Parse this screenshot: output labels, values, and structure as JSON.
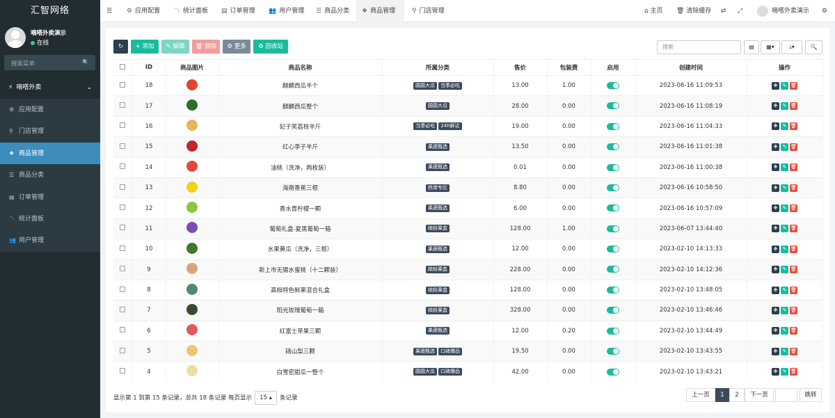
{
  "sidebar": {
    "brand": "汇智网络",
    "user_name": "嘀嗒外卖演示",
    "user_status": "在线",
    "search_placeholder": "搜索菜单",
    "group_label": "嘀嗒外卖",
    "items": [
      {
        "label": "应用配置",
        "icon": "gear-icon"
      },
      {
        "label": "门店管理",
        "icon": "map-marker-icon"
      },
      {
        "label": "商品管理",
        "icon": "cubes-icon",
        "active": true
      },
      {
        "label": "商品分类",
        "icon": "list-icon"
      },
      {
        "label": "订单管理",
        "icon": "file-icon"
      },
      {
        "label": "统计面板",
        "icon": "chart-icon"
      },
      {
        "label": "用户管理",
        "icon": "users-icon"
      }
    ]
  },
  "topbar": {
    "tabs": [
      {
        "label": "应用配置"
      },
      {
        "label": "统计面板"
      },
      {
        "label": "订单管理"
      },
      {
        "label": "用户管理"
      },
      {
        "label": "商品分类"
      },
      {
        "label": "商品管理",
        "active": true
      },
      {
        "label": "门店管理"
      }
    ],
    "home": "主页",
    "clear_cache": "清除缓存",
    "user_name": "嘀嗒外卖演示"
  },
  "toolbar": {
    "add": "添加",
    "edit": "编辑",
    "delete": "删除",
    "more": "更多",
    "recycle": "回收站",
    "search_placeholder": "搜索"
  },
  "table": {
    "headers": [
      "ID",
      "商品图片",
      "商品名称",
      "所属分类",
      "售价",
      "包装费",
      "启用",
      "创建时间",
      "操作"
    ],
    "rows": [
      {
        "id": "18",
        "name": "麒麟西瓜半个",
        "tags": [
          "圆圆大瓜",
          "当季必吃"
        ],
        "price": "13.00",
        "pack": "1.00",
        "time": "2023-06-16 11:09:53",
        "color": "#e0452f"
      },
      {
        "id": "17",
        "name": "麒麟西瓜整个",
        "tags": [
          "圆圆大瓜"
        ],
        "price": "28.00",
        "pack": "0.00",
        "time": "2023-06-16 11:08:19",
        "color": "#2f6b2a"
      },
      {
        "id": "16",
        "name": "妃子笑荔枝半斤",
        "tags": [
          "当季必吃",
          "24h鲜达"
        ],
        "price": "19.00",
        "pack": "0.00",
        "time": "2023-06-16 11:04:33",
        "color": "#e7b45a"
      },
      {
        "id": "15",
        "name": "红心李子半斤",
        "tags": [
          "果蔬甄选"
        ],
        "price": "13.50",
        "pack": "0.00",
        "time": "2023-06-16 11:01:38",
        "color": "#c0262b"
      },
      {
        "id": "14",
        "name": "油桃（洗净，两枚装）",
        "tags": [
          "果蔬甄选"
        ],
        "price": "0.01",
        "pack": "0.00",
        "time": "2023-06-16 11:00:38",
        "color": "#e04a3c"
      },
      {
        "id": "13",
        "name": "海南香蕉三根",
        "tags": [
          "热带专区"
        ],
        "price": "8.80",
        "pack": "0.00",
        "time": "2023-06-16 10:58:50",
        "color": "#f3cf1e"
      },
      {
        "id": "12",
        "name": "香水青柠檬一颗",
        "tags": [
          "果蔬甄选"
        ],
        "price": "6.00",
        "pack": "0.00",
        "time": "2023-06-16 10:57:09",
        "color": "#8cc63f"
      },
      {
        "id": "11",
        "name": "葡萄礼盒-夏黑葡萄一箱",
        "tags": [
          "缤纷果盒"
        ],
        "price": "128.00",
        "pack": "1.00",
        "time": "2023-06-07 13:44:40",
        "color": "#7a4fb5"
      },
      {
        "id": "10",
        "name": "水果黄瓜（洗净，三根）",
        "tags": [
          "果蔬甄选"
        ],
        "price": "12.00",
        "pack": "0.00",
        "time": "2023-02-10 14:13:33",
        "color": "#3d7a2a"
      },
      {
        "id": "9",
        "name": "新上市无锡水蜜桃（十二颗装）",
        "tags": [
          "缤纷果盒"
        ],
        "price": "228.00",
        "pack": "0.00",
        "time": "2023-02-10 14:12:36",
        "color": "#d9a47a"
      },
      {
        "id": "8",
        "name": "高档特色鲜果混合礼盒",
        "tags": [
          "缤纷果盒"
        ],
        "price": "128.00",
        "pack": "0.00",
        "time": "2023-02-10 13:48:05",
        "color": "#4e8a6e"
      },
      {
        "id": "7",
        "name": "阳光玫瑰葡萄一箱",
        "tags": [
          "缤纷果盒"
        ],
        "price": "328.00",
        "pack": "0.00",
        "time": "2023-02-10 13:46:46",
        "color": "#3b4a2e"
      },
      {
        "id": "6",
        "name": "红富士苹果三颗",
        "tags": [
          "果蔬甄选"
        ],
        "price": "12.00",
        "pack": "0.20",
        "time": "2023-02-10 13:44:49",
        "color": "#e05a5a"
      },
      {
        "id": "5",
        "name": "砀山梨三颗",
        "tags": [
          "果蔬甄选",
          "口碑爆品"
        ],
        "price": "19.50",
        "pack": "0.00",
        "time": "2023-02-10 13:43:55",
        "color": "#e9c86a"
      },
      {
        "id": "4",
        "name": "白雪密甜瓜一整个",
        "tags": [
          "圆圆大瓜",
          "口碑爆品"
        ],
        "price": "42.00",
        "pack": "0.00",
        "time": "2023-02-10 13:43:21",
        "color": "#e8e0a0"
      }
    ]
  },
  "footer": {
    "summary": "显示第 1 到第 15 条记录，总共 18 条记录 每页显示",
    "page_size": "15",
    "suffix": "条记录",
    "prev": "上一页",
    "page1": "1",
    "page2": "2",
    "next": "下一页",
    "jump": "跳转"
  },
  "colors": {
    "sidebar_bg": "#222d32",
    "active": "#3c8dbc",
    "refresh": "#2c3e50",
    "add": "#18bc9c",
    "edit": "#7dd5c3",
    "delete": "#f39c9c",
    "more": "#7b8a9a",
    "recycle": "#18bc9c",
    "drag": "#2c3e50",
    "edit_row": "#18bc9c",
    "del_row": "#e74c3c"
  }
}
